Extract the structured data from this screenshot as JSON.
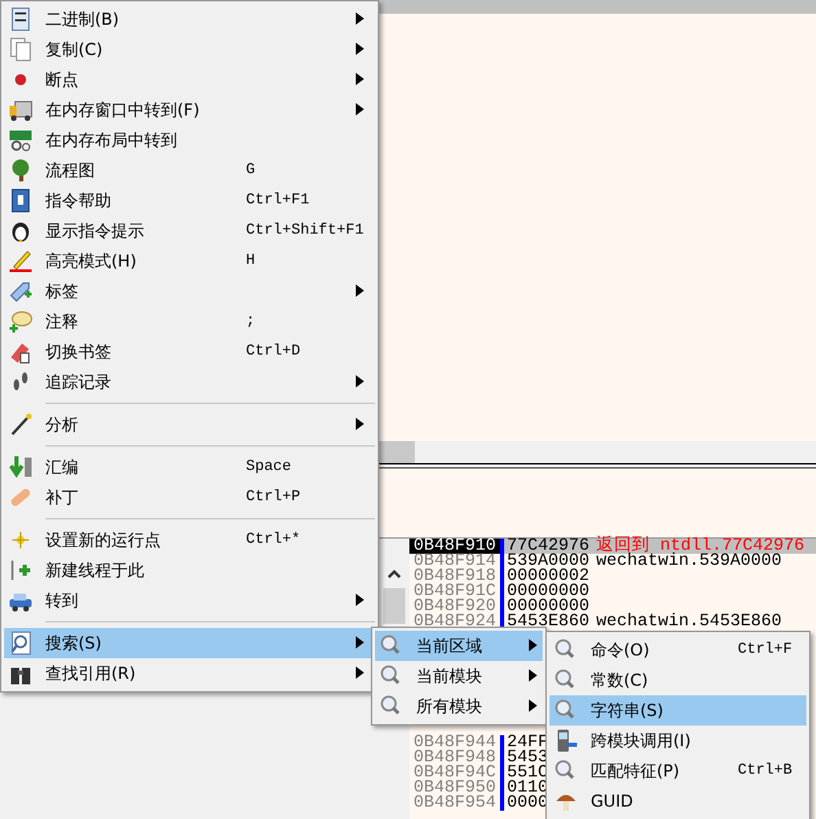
{
  "context_menu": {
    "items": [
      {
        "kind": "item",
        "label": "二进制(B)",
        "has_submenu": true,
        "selected": false
      },
      {
        "kind": "item",
        "label": "复制(C)",
        "has_submenu": true,
        "selected": false
      },
      {
        "kind": "item",
        "label": "断点",
        "has_submenu": true,
        "selected": false
      },
      {
        "kind": "item",
        "label": "在内存窗口中转到(F)",
        "has_submenu": true,
        "selected": false
      },
      {
        "kind": "item",
        "label": "在内存布局中转到",
        "has_submenu": false,
        "selected": false
      },
      {
        "kind": "item",
        "label": "流程图",
        "shortcut": "G",
        "has_submenu": false,
        "selected": false
      },
      {
        "kind": "item",
        "label": "指令帮助",
        "shortcut": "Ctrl+F1",
        "has_submenu": false,
        "selected": false
      },
      {
        "kind": "item",
        "label": "显示指令提示",
        "shortcut": "Ctrl+Shift+F1",
        "has_submenu": false,
        "selected": false
      },
      {
        "kind": "item",
        "label": "高亮模式(H)",
        "shortcut": "H",
        "has_submenu": false,
        "selected": false
      },
      {
        "kind": "item",
        "label": "标签",
        "has_submenu": true,
        "selected": false
      },
      {
        "kind": "item",
        "label": "注释",
        "shortcut": ";",
        "has_submenu": false,
        "selected": false
      },
      {
        "kind": "item",
        "label": "切换书签",
        "shortcut": "Ctrl+D",
        "has_submenu": false,
        "selected": false
      },
      {
        "kind": "item",
        "label": "追踪记录",
        "has_submenu": true,
        "selected": false
      },
      {
        "kind": "separator"
      },
      {
        "kind": "item",
        "label": "分析",
        "has_submenu": true,
        "selected": false
      },
      {
        "kind": "separator"
      },
      {
        "kind": "item",
        "label": "汇编",
        "shortcut": "Space",
        "has_submenu": false,
        "selected": false
      },
      {
        "kind": "item",
        "label": "补丁",
        "shortcut": "Ctrl+P",
        "has_submenu": false,
        "selected": false
      },
      {
        "kind": "separator"
      },
      {
        "kind": "item",
        "label": "设置新的运行点",
        "shortcut": "Ctrl+*",
        "has_submenu": false,
        "selected": false
      },
      {
        "kind": "item",
        "label": "新建线程于此",
        "has_submenu": false,
        "selected": false
      },
      {
        "kind": "item",
        "label": "转到",
        "has_submenu": true,
        "selected": false
      },
      {
        "kind": "separator"
      },
      {
        "kind": "item",
        "label": "搜索(S)",
        "has_submenu": true,
        "selected": true
      },
      {
        "kind": "item",
        "label": "查找引用(R)",
        "has_submenu": true,
        "selected": false
      }
    ]
  },
  "search_submenu": {
    "items": [
      {
        "label": "当前区域",
        "has_submenu": true,
        "selected": true
      },
      {
        "label": "当前模块",
        "has_submenu": true,
        "selected": false
      },
      {
        "label": "所有模块",
        "has_submenu": true,
        "selected": false
      }
    ]
  },
  "region_submenu": {
    "items": [
      {
        "label": "命令(O)",
        "shortcut": "Ctrl+F",
        "selected": false
      },
      {
        "label": "常数(C)",
        "selected": false
      },
      {
        "label": "字符串(S)",
        "selected": true
      },
      {
        "label": "跨模块调用(I)",
        "selected": false
      },
      {
        "label": "匹配特征(P)",
        "shortcut": "Ctrl+B",
        "selected": false
      },
      {
        "label": "GUID",
        "selected": false
      }
    ]
  },
  "stack": {
    "rows_top": [
      {
        "address": "0B48F910",
        "value": "77C42976",
        "comment": "返回到 ntdll.77C42976",
        "selected": true
      },
      {
        "address": "0B48F914",
        "value": "539A0000",
        "comment": "wechatwin.539A0000",
        "selected": false
      },
      {
        "address": "0B48F918",
        "value": "00000002",
        "selected": false
      },
      {
        "address": "0B48F91C",
        "value": "00000000",
        "selected": false
      },
      {
        "address": "0B48F920",
        "value": "00000000",
        "selected": false
      },
      {
        "address": "0B48F924",
        "value": "5453E860",
        "comment": "wechatwin.5453E860",
        "selected": false
      }
    ],
    "rows_bottom": [
      {
        "address": "0B48F944",
        "value": "24FF",
        "selected": false
      },
      {
        "address": "0B48F948",
        "value": "5453",
        "selected": false
      },
      {
        "address": "0B48F94C",
        "value": "551C",
        "selected": false
      },
      {
        "address": "0B48F950",
        "value": "0110",
        "selected": false
      },
      {
        "address": "0B48F954",
        "value": "0000",
        "selected": false
      }
    ]
  }
}
